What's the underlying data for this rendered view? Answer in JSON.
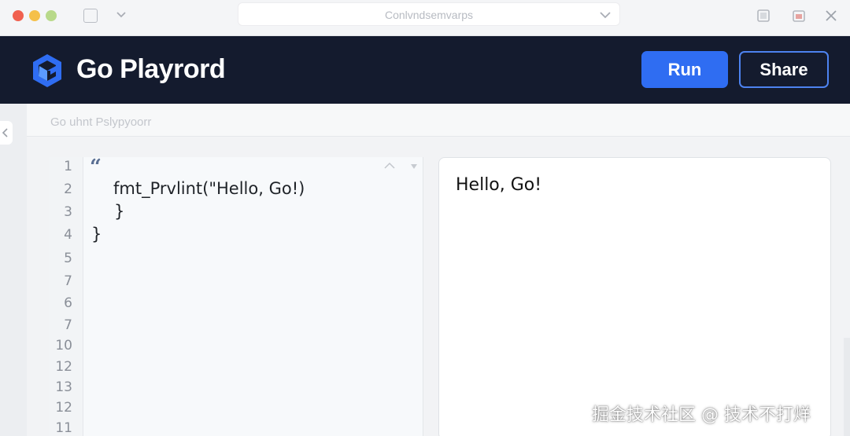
{
  "browser": {
    "address_text": "Conlvndsemvarps"
  },
  "header": {
    "brand": "Go Playrord",
    "run_label": "Run",
    "share_label": "Share"
  },
  "subbar": {
    "title": "Go uhnt Pslypyoorr"
  },
  "editor": {
    "line_numbers": [
      "1",
      "2",
      "3",
      "4",
      "5",
      "7",
      "6",
      "7",
      "10",
      "12",
      "13",
      "12",
      "11"
    ],
    "open_quote": "“",
    "lines": [
      "fmt_Prvlint(\"Hello, Go!)",
      "}",
      "}"
    ]
  },
  "output": {
    "text": "Hello, Go!"
  },
  "watermark": {
    "text": "掘金技术社区 @ 技术不打烊"
  },
  "colors": {
    "header_bg": "#141b2e",
    "run_button": "#2f6df2",
    "share_border": "#4d83f0"
  }
}
